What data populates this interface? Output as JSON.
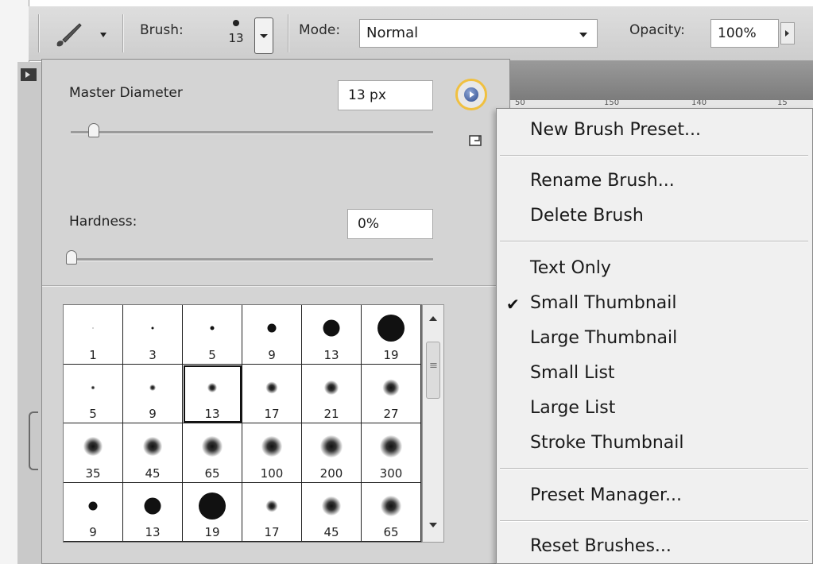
{
  "toolbar": {
    "brush_label": "Brush:",
    "brush_size": "13",
    "mode_label": "Mode:",
    "mode_value": "Normal",
    "opacity_label": "Opacity:",
    "opacity_value": "100%"
  },
  "ruler_ticks": [
    "50",
    "150",
    "140",
    "15"
  ],
  "brush_panel": {
    "master_diameter_label": "Master Diameter",
    "master_diameter_value": "13 px",
    "hardness_label": "Hardness:",
    "hardness_value": "0%",
    "presets": [
      {
        "size": "1",
        "tip": 1,
        "soft": false
      },
      {
        "size": "3",
        "tip": 3,
        "soft": false
      },
      {
        "size": "5",
        "tip": 5,
        "soft": false
      },
      {
        "size": "9",
        "tip": 11,
        "soft": false
      },
      {
        "size": "13",
        "tip": 21,
        "soft": false
      },
      {
        "size": "19",
        "tip": 34,
        "soft": false
      },
      {
        "size": "5",
        "tip": 5,
        "soft": true
      },
      {
        "size": "9",
        "tip": 8,
        "soft": true
      },
      {
        "size": "13",
        "tip": 12,
        "soft": true,
        "selected": true
      },
      {
        "size": "17",
        "tip": 15,
        "soft": true
      },
      {
        "size": "21",
        "tip": 18,
        "soft": true
      },
      {
        "size": "27",
        "tip": 21,
        "soft": true
      },
      {
        "size": "35",
        "tip": 24,
        "soft": true
      },
      {
        "size": "45",
        "tip": 24,
        "soft": true
      },
      {
        "size": "65",
        "tip": 26,
        "soft": true
      },
      {
        "size": "100",
        "tip": 26,
        "soft": true
      },
      {
        "size": "200",
        "tip": 28,
        "soft": true
      },
      {
        "size": "300",
        "tip": 28,
        "soft": true
      },
      {
        "size": "9",
        "tip": 11,
        "soft": false
      },
      {
        "size": "13",
        "tip": 21,
        "soft": false
      },
      {
        "size": "19",
        "tip": 34,
        "soft": false
      },
      {
        "size": "17",
        "tip": 15,
        "soft": true
      },
      {
        "size": "45",
        "tip": 24,
        "soft": true
      },
      {
        "size": "65",
        "tip": 26,
        "soft": true
      }
    ]
  },
  "menu": {
    "new_brush_preset": "New Brush Preset...",
    "rename_brush": "Rename Brush...",
    "delete_brush": "Delete Brush",
    "text_only": "Text Only",
    "small_thumbnail": "Small Thumbnail",
    "large_thumbnail": "Large Thumbnail",
    "small_list": "Small List",
    "large_list": "Large List",
    "stroke_thumbnail": "Stroke Thumbnail",
    "preset_manager": "Preset Manager...",
    "reset_brushes": "Reset Brushes...",
    "checkmark": "✔"
  },
  "colors": {
    "highlight_ring": "#f0c040",
    "panel_bg": "#d4d4d4",
    "menu_bg": "#f0f0f0"
  }
}
